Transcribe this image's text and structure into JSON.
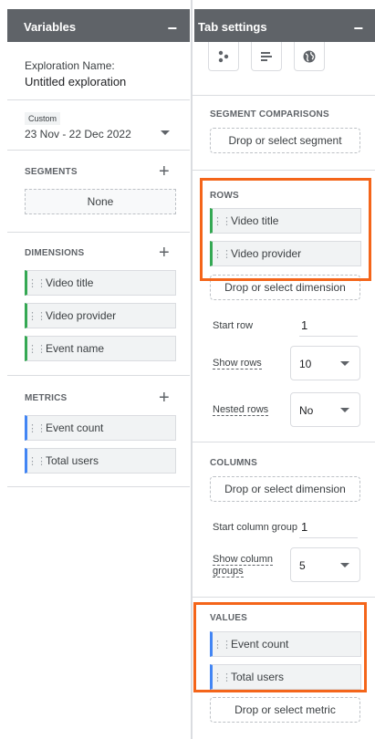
{
  "variables": {
    "header_title": "Variables",
    "exploration_label": "Exploration Name:",
    "exploration_name": "Untitled exploration",
    "date": {
      "badge": "Custom",
      "range": "23 Nov - 22 Dec 2022"
    },
    "segments": {
      "title": "SEGMENTS",
      "empty_label": "None"
    },
    "dimensions": {
      "title": "DIMENSIONS",
      "items": [
        "Video title",
        "Video provider",
        "Event name"
      ]
    },
    "metrics": {
      "title": "METRICS",
      "items": [
        "Event count",
        "Total users"
      ]
    }
  },
  "tab_settings": {
    "header_title": "Tab settings",
    "icons": [
      "scatter-icon",
      "bar-list-icon",
      "globe-icon"
    ],
    "segment_comparisons": {
      "title": "SEGMENT COMPARISONS",
      "drop_label": "Drop or select segment"
    },
    "rows": {
      "title": "ROWS",
      "items": [
        "Video title",
        "Video provider"
      ],
      "drop_label": "Drop or select dimension",
      "start_row_label": "Start row",
      "start_row_value": "1",
      "show_rows_label": "Show rows",
      "show_rows_value": "10",
      "nested_rows_label": "Nested rows",
      "nested_rows_value": "No"
    },
    "columns": {
      "title": "COLUMNS",
      "drop_label": "Drop or select dimension",
      "start_group_label": "Start column group",
      "start_group_value": "1",
      "show_groups_label_1": "Show column",
      "show_groups_label_2": "groups",
      "show_groups_value": "5"
    },
    "values": {
      "title": "VALUES",
      "items": [
        "Event count",
        "Total users"
      ],
      "drop_label": "Drop or select metric"
    }
  },
  "colors": {
    "header": "#5f6368",
    "dimension_accent": "#34a853",
    "metric_accent": "#4285f4",
    "highlight": "#f4651a"
  }
}
